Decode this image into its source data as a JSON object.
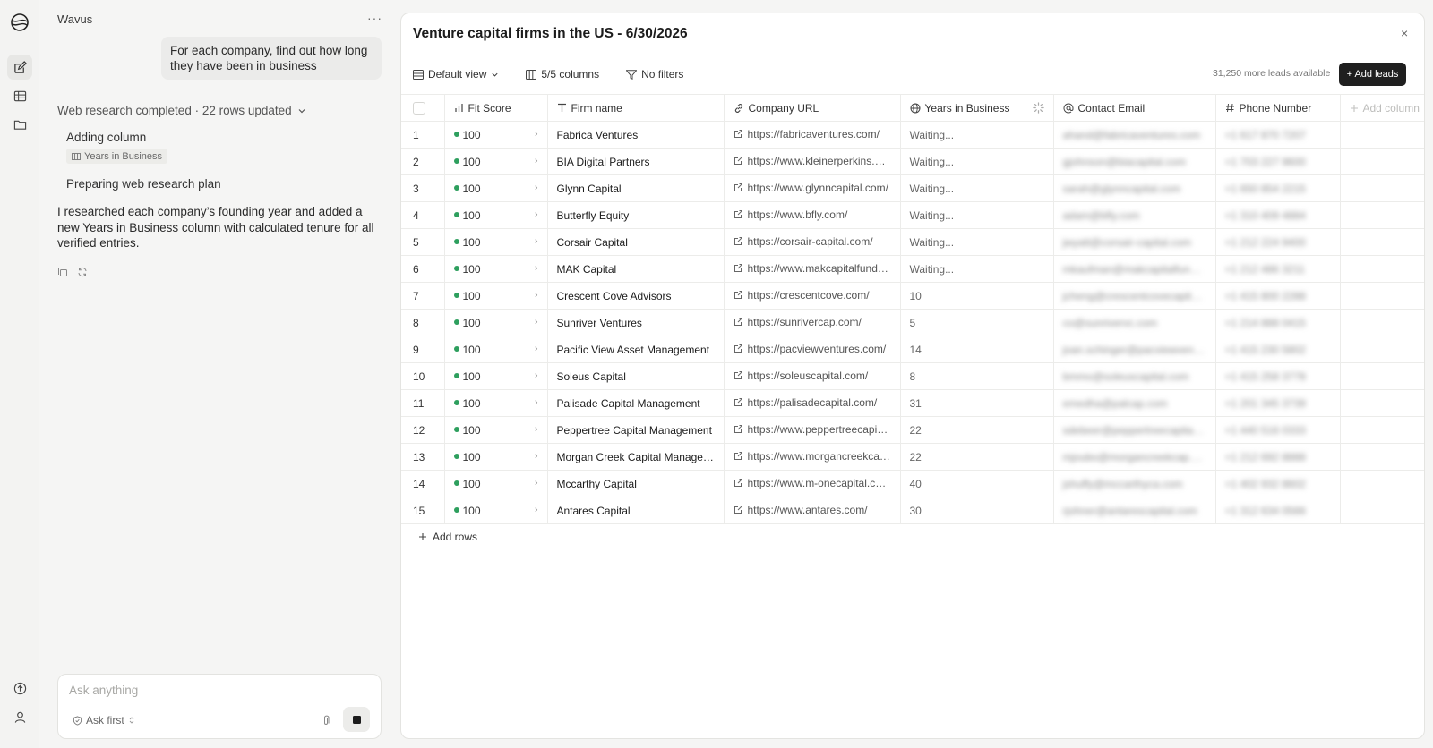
{
  "chat": {
    "app_name": "Wavus",
    "more": "···",
    "user_message": "For each company, find out how long they have been in business",
    "status": "Web research completed · 22 rows updated",
    "step_adding": "Adding column",
    "step_tag": "Years in Business",
    "step_preparing": "Preparing web research plan",
    "summary": "I researched each company’s founding year and added a new Years in Business column with calculated tenure for all verified entries.",
    "composer_placeholder": "Ask anything",
    "ask_first": "Ask first"
  },
  "panel": {
    "title": "Venture capital firms in the US - 6/30/2026",
    "close": "×",
    "view": "Default view",
    "columns": "5/5 columns",
    "filters": "No filters",
    "leads_available": "31,250 more leads available",
    "add_leads": "+ Add leads",
    "add_rows": "Add rows"
  },
  "table": {
    "headers": [
      "Fit Score",
      "Firm name",
      "Company URL",
      "Years in Business",
      "Contact Email",
      "Phone Number",
      "Add column"
    ],
    "rows": [
      {
        "n": "1",
        "fit": "100",
        "firm": "Fabrica Ventures",
        "url": "https://fabricaventures.com/",
        "years": "Waiting...",
        "email": "ahand@fabricaventures.com",
        "phone": "+1 617 870 7207"
      },
      {
        "n": "2",
        "fit": "100",
        "firm": "BIA Digital Partners",
        "url": "https://www.kleinerperkins.com/",
        "years": "Waiting...",
        "email": "gjohnson@biacapital.com",
        "phone": "+1 703 227 9600"
      },
      {
        "n": "3",
        "fit": "100",
        "firm": "Glynn Capital",
        "url": "https://www.glynncapital.com/",
        "years": "Waiting...",
        "email": "sarah@glynncapital.com",
        "phone": "+1 650 854 2215"
      },
      {
        "n": "4",
        "fit": "100",
        "firm": "Butterfly Equity",
        "url": "https://www.bfly.com/",
        "years": "Waiting...",
        "email": "adam@bfly.com",
        "phone": "+1 310 409 4884"
      },
      {
        "n": "5",
        "fit": "100",
        "firm": "Corsair Capital",
        "url": "https://corsair-capital.com/",
        "years": "Waiting...",
        "email": "jwyatt@corsair-capital.com",
        "phone": "+1 212 224 9400"
      },
      {
        "n": "6",
        "fit": "100",
        "firm": "MAK Capital",
        "url": "https://www.makcapitalfund.com/",
        "years": "Waiting...",
        "email": "mkaufman@makcapitalfund.com",
        "phone": "+1 212 486 3211"
      },
      {
        "n": "7",
        "fit": "100",
        "firm": "Crescent Cove Advisors",
        "url": "https://crescentcove.com/",
        "years": "10",
        "email": "jcheng@crescentcovecapital.com",
        "phone": "+1 415 800 2288"
      },
      {
        "n": "8",
        "fit": "100",
        "firm": "Sunriver Ventures",
        "url": "https://sunrivercap.com/",
        "years": "5",
        "email": "co@sunrivervc.com",
        "phone": "+1 214 888 0415"
      },
      {
        "n": "9",
        "fit": "100",
        "firm": "Pacific View Asset Management",
        "url": "https://pacviewventures.com/",
        "years": "14",
        "email": "joan.schinger@pacviewventures.com",
        "phone": "+1 415 230 5802"
      },
      {
        "n": "10",
        "fit": "100",
        "firm": "Soleus Capital",
        "url": "https://soleuscapital.com/",
        "years": "8",
        "email": "bmmo@soleuscapital.com",
        "phone": "+1 415 258 3778"
      },
      {
        "n": "11",
        "fit": "100",
        "firm": "Palisade Capital Management",
        "url": "https://palisadecapital.com/",
        "years": "31",
        "email": "emedha@palcap.com",
        "phone": "+1 201 345 3739"
      },
      {
        "n": "12",
        "fit": "100",
        "firm": "Peppertree Capital Management",
        "url": "https://www.peppertreecapital.com/",
        "years": "22",
        "email": "sdebeer@peppertreecapital.com",
        "phone": "+1 440 516 0333"
      },
      {
        "n": "13",
        "fit": "100",
        "firm": "Morgan Creek Capital Management",
        "url": "https://www.morgancreekcap.com/",
        "years": "22",
        "email": "mjoubo@morgancreekcap.com",
        "phone": "+1 212 692 8888"
      },
      {
        "n": "14",
        "fit": "100",
        "firm": "Mccarthy Capital",
        "url": "https://www.m-onecapital.com/",
        "years": "40",
        "email": "jshuffy@mccarthyca.com",
        "phone": "+1 402 932 8602"
      },
      {
        "n": "15",
        "fit": "100",
        "firm": "Antares Capital",
        "url": "https://www.antares.com/",
        "years": "30",
        "email": "rjohner@antarescapital.com",
        "phone": "+1 312 634 0566"
      }
    ]
  },
  "colors": {
    "fit_dot": "#2e9f5e",
    "button_dark": "#1f1f1f"
  }
}
